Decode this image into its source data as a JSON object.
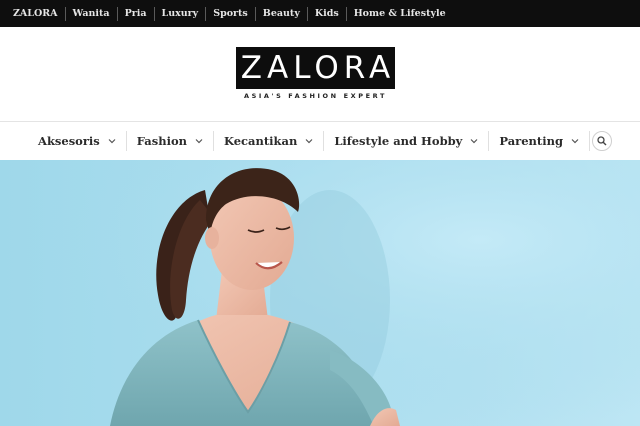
{
  "topbar": {
    "items": [
      "ZALORA",
      "Wanita",
      "Pria",
      "Luxury",
      "Sports",
      "Beauty",
      "Kids",
      "Home & Lifestyle"
    ]
  },
  "logo": {
    "wordmark": "ZALORA",
    "tagline": "ASIA'S FASHION EXPERT"
  },
  "nav": {
    "items": [
      "Aksesoris",
      "Fashion",
      "Kecantikan",
      "Lifestyle and Hobby",
      "Parenting"
    ],
    "search_icon": "search-icon",
    "dropdown_icon": "chevron-down-icon"
  },
  "hero": {
    "image": "smiling woman with ponytail in light blue top against blue wall",
    "background_color": "#a9ddee"
  },
  "colors": {
    "topbar_bg": "#0e0e0e",
    "logo_bg": "#0d0d0d",
    "text": "#2b2b2b"
  }
}
